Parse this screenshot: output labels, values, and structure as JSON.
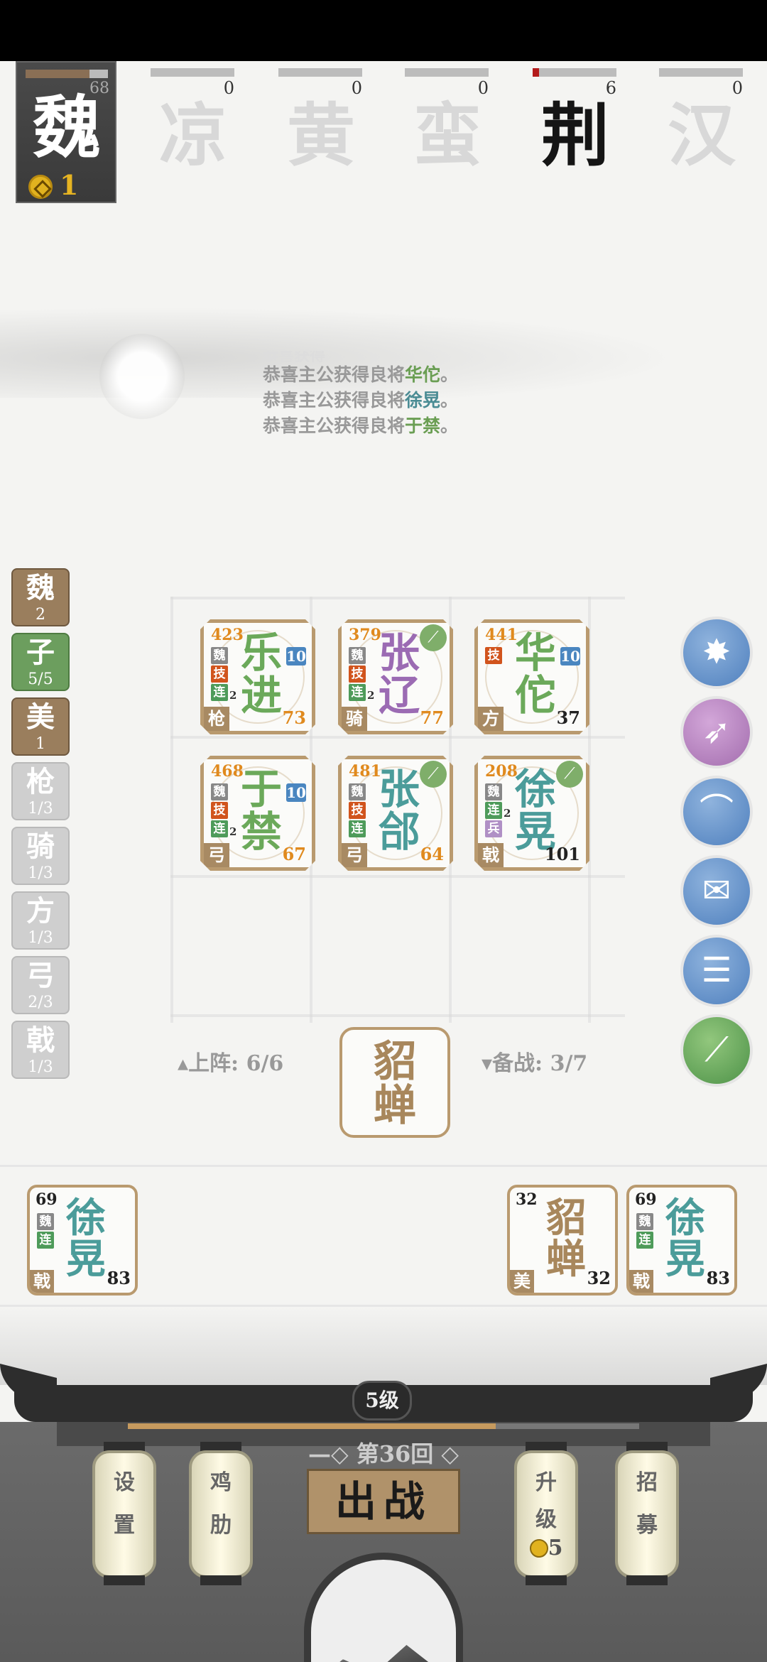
{
  "own": {
    "faction": "魏",
    "hp": 68,
    "hp_fraction": 0.78,
    "coins": "1"
  },
  "factions": [
    {
      "char": "凉",
      "hp": "0",
      "active": false,
      "hp_fraction": 0
    },
    {
      "char": "黄",
      "hp": "0",
      "active": false,
      "hp_fraction": 0
    },
    {
      "char": "蛮",
      "hp": "0",
      "active": false,
      "hp_fraction": 0
    },
    {
      "char": "荆",
      "hp": "6",
      "active": true,
      "hp_fraction": 0.08
    },
    {
      "char": "汉",
      "hp": "0",
      "active": false,
      "hp_fraction": 0
    }
  ],
  "messages": [
    {
      "prefix": "恭喜主公获得良将",
      "name": "华佗",
      "suffix": "。"
    },
    {
      "prefix": "恭喜主公获得良将",
      "name": "徐晃",
      "suffix": "。"
    },
    {
      "prefix": "恭喜主公获得良将",
      "name": "于禁",
      "suffix": "。"
    }
  ],
  "filters": [
    {
      "label": "魏",
      "count": "2",
      "style": "brown"
    },
    {
      "label": "子",
      "count": "5/5",
      "style": "green"
    },
    {
      "label": "美",
      "count": "1",
      "style": "brown"
    },
    {
      "label": "枪",
      "count": "1/3",
      "style": "gray"
    },
    {
      "label": "骑",
      "count": "1/3",
      "style": "gray"
    },
    {
      "label": "方",
      "count": "1/3",
      "style": "gray"
    },
    {
      "label": "弓",
      "count": "2/3",
      "style": "gray"
    },
    {
      "label": "戟",
      "count": "1/3",
      "style": "gray"
    }
  ],
  "board": [
    {
      "atk": "423",
      "name1": "乐",
      "name2": "进",
      "level": "10",
      "hp": "73",
      "weapon": "枪",
      "color": "green",
      "tags": [
        {
          "t": "魏",
          "c": "wei"
        },
        {
          "t": "技",
          "c": "ji"
        },
        {
          "t": "连",
          "c": "lian",
          "sub": "2"
        }
      ]
    },
    {
      "atk": "379",
      "name1": "张",
      "name2": "辽",
      "level": "",
      "hp": "77",
      "weapon": "骑",
      "color": "purple",
      "tags": [
        {
          "t": "魏",
          "c": "wei"
        },
        {
          "t": "技",
          "c": "ji"
        },
        {
          "t": "连",
          "c": "lian",
          "sub": "2"
        }
      ]
    },
    {
      "atk": "441",
      "name1": "华",
      "name2": "佗",
      "level": "10",
      "hp": "37",
      "weapon": "方",
      "color": "green",
      "tags": [
        {
          "t": "技",
          "c": "ji"
        }
      ]
    },
    {
      "atk": "468",
      "name1": "于",
      "name2": "禁",
      "level": "10",
      "hp": "67",
      "weapon": "弓",
      "color": "green",
      "tags": [
        {
          "t": "魏",
          "c": "wei"
        },
        {
          "t": "技",
          "c": "ji"
        },
        {
          "t": "连",
          "c": "lian",
          "sub": "2"
        }
      ]
    },
    {
      "atk": "481",
      "name1": "张",
      "name2": "郃",
      "level": "",
      "hp": "64",
      "weapon": "弓",
      "color": "teal",
      "tags": [
        {
          "t": "魏",
          "c": "wei"
        },
        {
          "t": "技",
          "c": "ji"
        },
        {
          "t": "连",
          "c": "lian"
        }
      ]
    },
    {
      "atk": "208",
      "name1": "徐",
      "name2": "晃",
      "level": "",
      "hp": "101",
      "weapon": "戟",
      "color": "teal",
      "tags": [
        {
          "t": "魏",
          "c": "wei"
        },
        {
          "t": "连",
          "c": "lian",
          "sub": "2"
        },
        {
          "t": "兵",
          "c": "bing"
        }
      ]
    }
  ],
  "deploy": {
    "label": "上阵: 6/6"
  },
  "reserve": {
    "label": "备战: 3/7"
  },
  "center": {
    "name1": "貂",
    "name2": "蝉"
  },
  "bench": [
    {
      "atk": "69",
      "name1": "徐",
      "name2": "晃",
      "hp": "83",
      "weapon": "戟",
      "color": "teal",
      "tags": [
        {
          "t": "魏",
          "c": "wei"
        },
        {
          "t": "连",
          "c": "lian"
        }
      ]
    },
    {
      "atk": "32",
      "name1": "貂",
      "name2": "蝉",
      "hp": "32",
      "weapon": "美",
      "color": "brown",
      "tags": []
    },
    {
      "atk": "69",
      "name1": "徐",
      "name2": "晃",
      "hp": "83",
      "weapon": "戟",
      "color": "teal",
      "tags": [
        {
          "t": "魏",
          "c": "wei"
        },
        {
          "t": "连",
          "c": "lian"
        }
      ]
    }
  ],
  "skills": [
    "burst",
    "crossbow",
    "bow",
    "scroll-letter",
    "scroll",
    "spear"
  ],
  "bottom": {
    "level": "5级",
    "xp_fraction": 0.72,
    "round": "第36回",
    "fight": "出战",
    "settings": [
      "设",
      "置"
    ],
    "chicken": [
      "鸡",
      "肋"
    ],
    "upgrade": [
      "升",
      "级"
    ],
    "upgrade_cost": "5",
    "recruit": [
      "招",
      "募"
    ]
  },
  "colors": {
    "green": "#6ba95a",
    "purple": "#9b6bb3",
    "teal": "#4b9c9a",
    "brown": "#a8875c"
  }
}
